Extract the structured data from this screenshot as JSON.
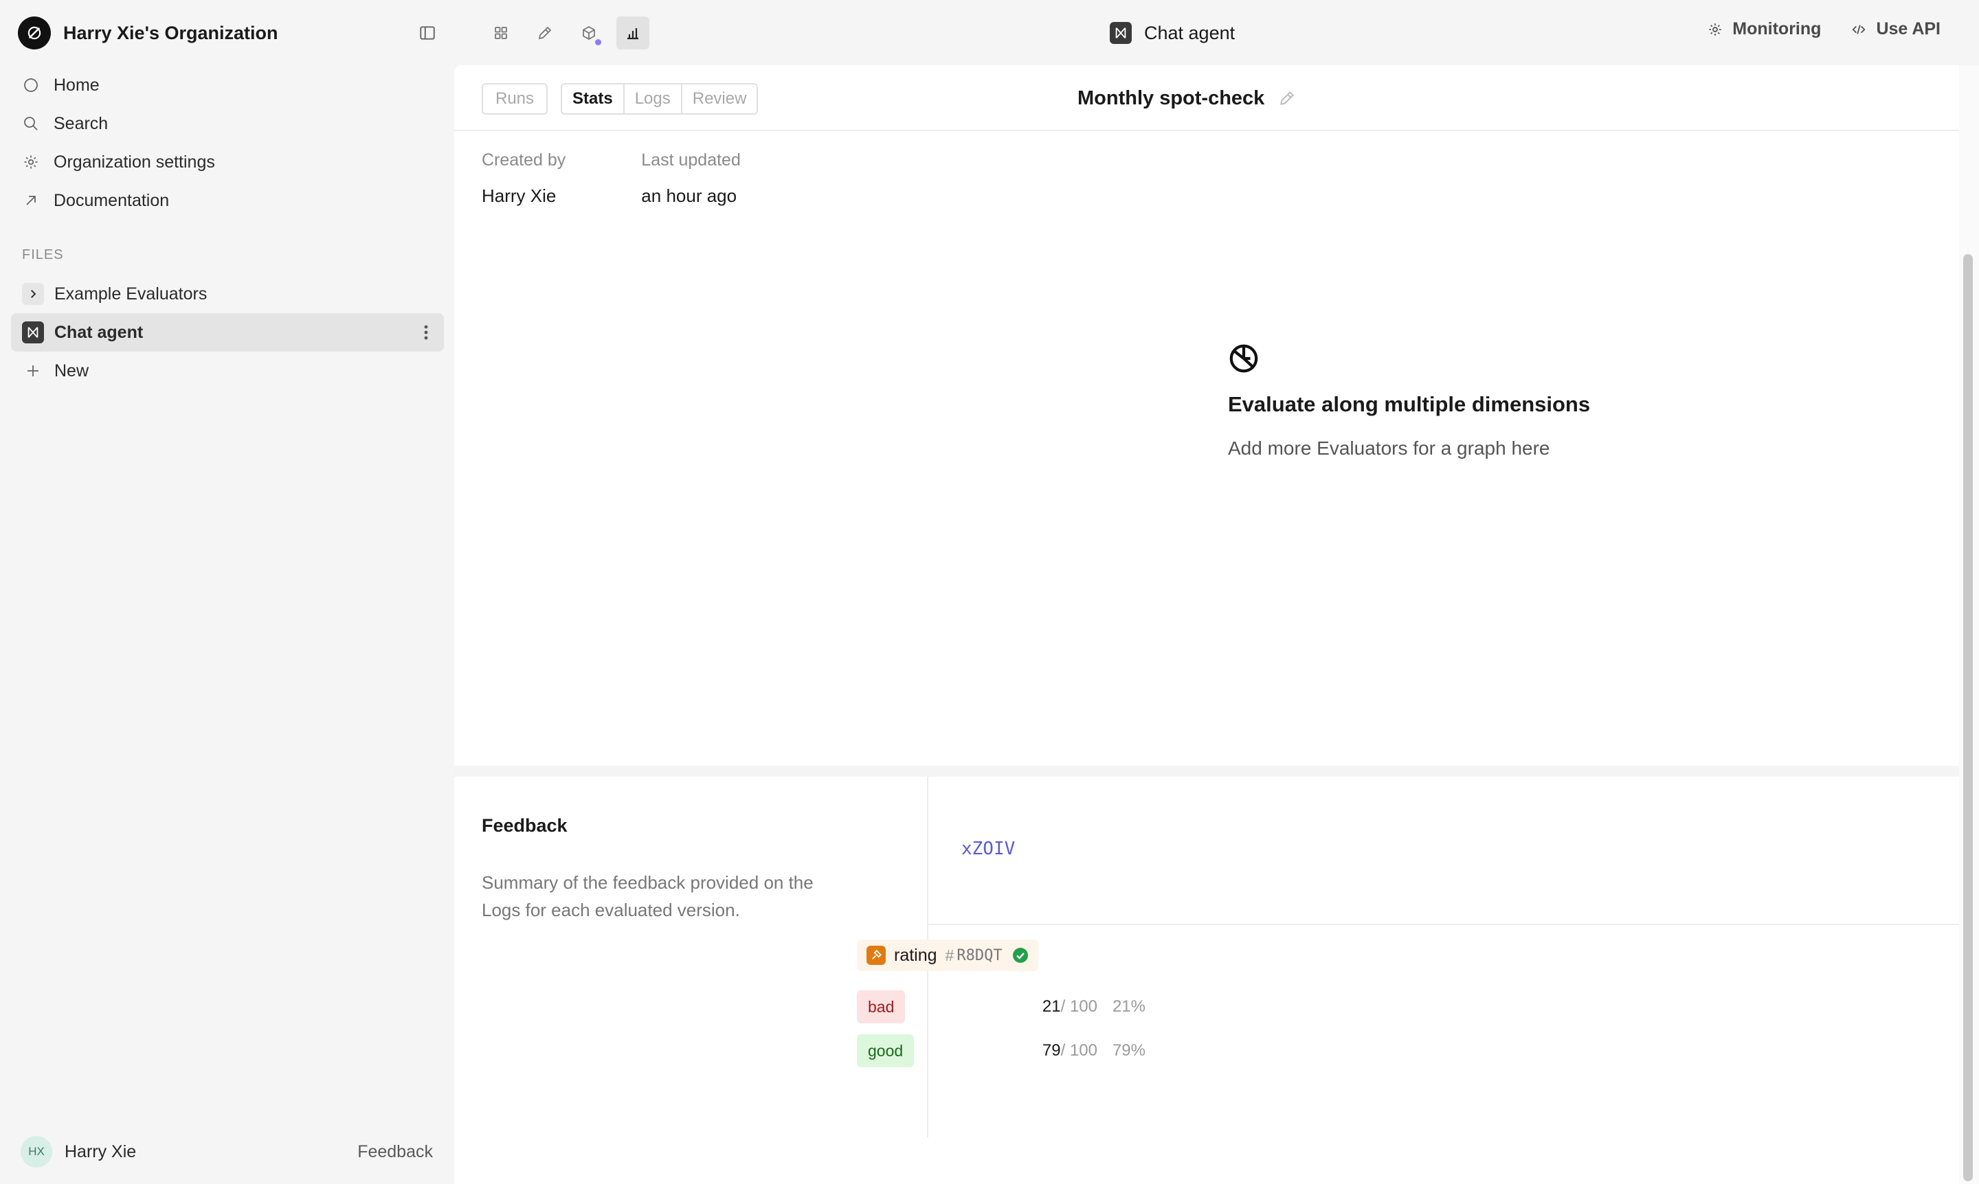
{
  "sidebar": {
    "org_name": "Harry Xie's Organization",
    "nav": [
      {
        "label": "Home",
        "icon": "circle-icon"
      },
      {
        "label": "Search",
        "icon": "search-icon"
      },
      {
        "label": "Organization settings",
        "icon": "gear-icon"
      },
      {
        "label": "Documentation",
        "icon": "arrow-up-right-icon"
      }
    ],
    "files_label": "FILES",
    "files": [
      {
        "label": "Example Evaluators",
        "icon": "chevron-right-icon"
      },
      {
        "label": "Chat agent",
        "icon": "agent-icon",
        "active": true
      },
      {
        "label": "New",
        "icon": "plus-icon"
      }
    ],
    "user": {
      "initials": "HX",
      "name": "Harry Xie"
    },
    "feedback_label": "Feedback"
  },
  "topbar": {
    "title": "Chat agent",
    "monitoring_label": "Monitoring",
    "use_api_label": "Use API"
  },
  "header": {
    "runs_label": "Runs",
    "tabs": [
      {
        "label": "Stats",
        "active": true
      },
      {
        "label": "Logs"
      },
      {
        "label": "Review"
      }
    ],
    "page_title": "Monthly spot-check"
  },
  "meta": {
    "created_by_label": "Created by",
    "created_by": "Harry Xie",
    "last_updated_label": "Last updated",
    "last_updated": "an hour ago"
  },
  "empty_state": {
    "title": "Evaluate along multiple dimensions",
    "subtitle": "Add more Evaluators for a graph here"
  },
  "feedback": {
    "title": "Feedback",
    "description": "Summary of the feedback provided on the Logs for each evaluated version.",
    "version_id": "xZOIV",
    "evaluator": {
      "name": "rating",
      "hash": "#",
      "code": "R8DQT",
      "rows": [
        {
          "label": "bad",
          "count": "21",
          "total": "/ 100",
          "pct": "21%"
        },
        {
          "label": "good",
          "count": "79",
          "total": "/ 100",
          "pct": "79%"
        }
      ]
    }
  },
  "colors": {
    "accent_purple": "#8b7cf6",
    "version_link": "#5b5bd6",
    "evaluator_orange": "#e07b12",
    "bad_bg": "#fde2e2",
    "good_bg": "#dcf7dc",
    "check_green": "#22a04b"
  }
}
